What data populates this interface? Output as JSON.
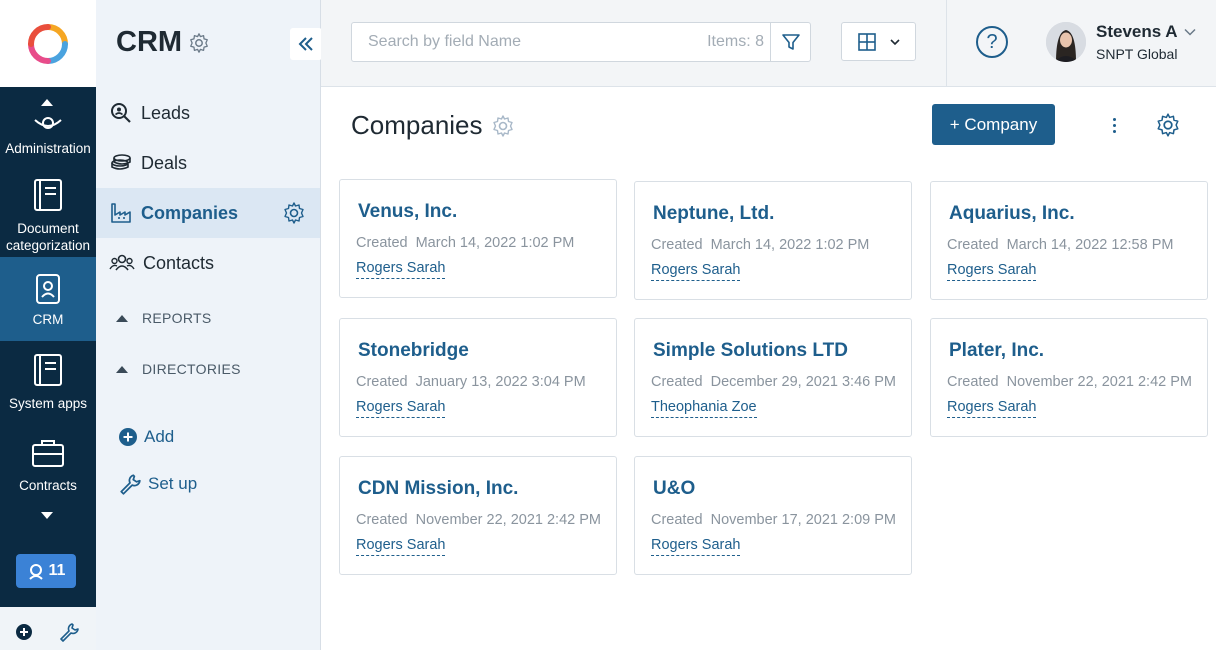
{
  "rail": {
    "items": [
      {
        "label": "Administration",
        "icon": "administration-icon"
      },
      {
        "label": "Document categorization",
        "icon": "book-icon"
      },
      {
        "label": "CRM",
        "icon": "crm-contact-icon"
      },
      {
        "label": "System apps",
        "icon": "book-icon"
      },
      {
        "label": "Contracts",
        "icon": "briefcase-icon"
      }
    ],
    "badge_count": "11"
  },
  "sidebar": {
    "title": "CRM",
    "items": [
      {
        "label": "Leads",
        "icon": "search-person-icon"
      },
      {
        "label": "Deals",
        "icon": "coins-icon"
      },
      {
        "label": "Companies",
        "icon": "factory-icon"
      },
      {
        "label": "Contacts",
        "icon": "people-icon"
      }
    ],
    "sections": [
      "REPORTS",
      "DIRECTORIES"
    ],
    "add_label": "Add",
    "setup_label": "Set up"
  },
  "topbar": {
    "search_placeholder": "Search by field Name",
    "items_count": "Items: 8",
    "user_name": "Stevens A",
    "user_org": "SNPT Global",
    "help": "?"
  },
  "main": {
    "title": "Companies",
    "add_button": "+ Company",
    "created_label": "Created"
  },
  "companies": [
    {
      "name": "Venus, Inc.",
      "created": "March 14, 2022 1:02 PM",
      "owner": "Rogers Sarah"
    },
    {
      "name": "Neptune, Ltd.",
      "created": "March 14, 2022 1:02 PM",
      "owner": "Rogers Sarah"
    },
    {
      "name": "Aquarius, Inc.",
      "created": "March 14, 2022 12:58 PM",
      "owner": "Rogers Sarah"
    },
    {
      "name": "Stonebridge",
      "created": "January 13, 2022 3:04 PM",
      "owner": "Rogers Sarah"
    },
    {
      "name": "Simple Solutions LTD",
      "created": "December 29, 2021 3:46 PM",
      "owner": "Theophania Zoe"
    },
    {
      "name": "Plater, Inc.",
      "created": "November 22, 2021 2:42 PM",
      "owner": "Rogers Sarah"
    },
    {
      "name": "CDN Mission, Inc.",
      "created": "November 22, 2021 2:42 PM",
      "owner": "Rogers Sarah"
    },
    {
      "name": "U&O",
      "created": "November 17, 2021 2:09 PM",
      "owner": "Rogers Sarah"
    }
  ],
  "colors": {
    "rail": "#0b2a42",
    "rail_active": "#1e5e8c",
    "accent": "#1e5e8c",
    "sidebar": "#eef3f9",
    "badge": "#3b82d6"
  }
}
